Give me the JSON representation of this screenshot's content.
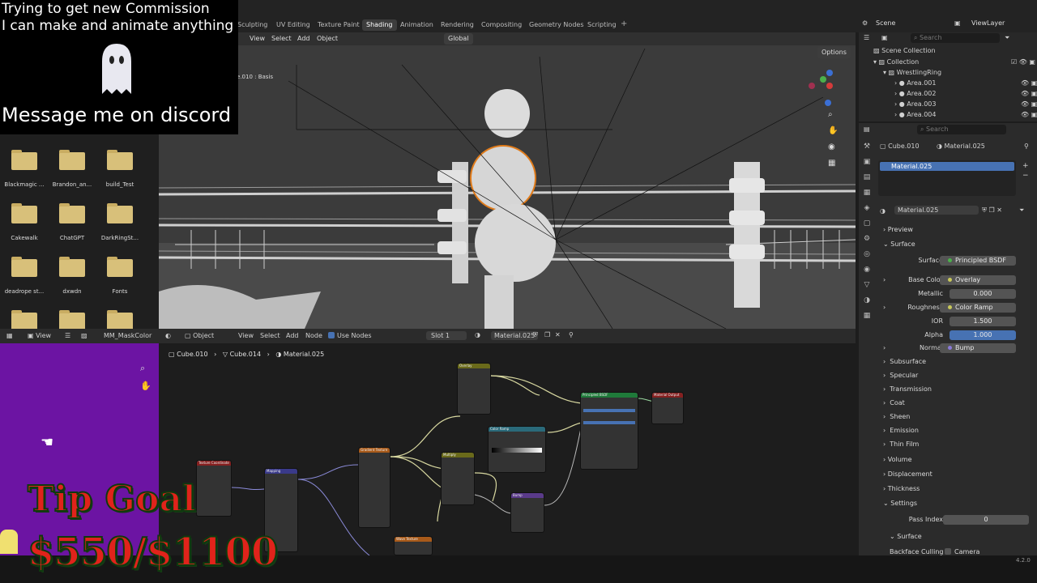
{
  "overlay": {
    "line1": "Trying to get new Commission",
    "line2": "I can make and animate anything",
    "line3": "Message me on discord"
  },
  "workspace_tabs": [
    "Sculpting",
    "UV Editing",
    "Texture Paint",
    "Shading",
    "Animation",
    "Rendering",
    "Compositing",
    "Geometry Nodes",
    "Scripting"
  ],
  "active_workspace": "Shading",
  "scene": "Scene",
  "view_layer": "ViewLayer",
  "viewport": {
    "menus": [
      "View",
      "Select",
      "Add",
      "Object"
    ],
    "orientation": "Global",
    "options": "Options",
    "object_label": "e.010 : Basis"
  },
  "files": [
    {
      "name": "Blackmagic ..."
    },
    {
      "name": "Brandon_an..."
    },
    {
      "name": "build_Test"
    },
    {
      "name": "Cakewalk"
    },
    {
      "name": "ChatGPT"
    },
    {
      "name": "DarkRingSt..."
    },
    {
      "name": "deadrope st..."
    },
    {
      "name": "dxwdn"
    },
    {
      "name": "Fonts"
    }
  ],
  "image_editor": {
    "view": "View",
    "image": "MM_MaskColor"
  },
  "node_editor": {
    "mode": "Object",
    "menus": [
      "View",
      "Select",
      "Add",
      "Node"
    ],
    "use_nodes": "Use Nodes",
    "slot": "Slot 1",
    "material": "Material.025",
    "breadcrumb": [
      "Cube.010",
      "Cube.014",
      "Material.025"
    ]
  },
  "nodes": [
    {
      "title": "Texture Coordinate",
      "color": "#862020"
    },
    {
      "title": "Mapping",
      "color": "#3a3a8a"
    },
    {
      "title": "Gradient Texture",
      "color": "#a85a1a"
    },
    {
      "title": "Overlay",
      "color": "#6a6a1a"
    },
    {
      "title": "Multiply",
      "color": "#6a6a1a"
    },
    {
      "title": "Color Ramp",
      "color": "#2a6a7a"
    },
    {
      "title": "Bump",
      "color": "#5a3a8a"
    },
    {
      "title": "Wave Texture",
      "color": "#a85a1a"
    },
    {
      "title": "Principled BSDF",
      "color": "#1f7a3a"
    },
    {
      "title": "Material Output",
      "color": "#862020"
    }
  ],
  "outliner": {
    "search": "Search",
    "root": "Scene Collection",
    "collection": "Collection",
    "group": "WrestlingRing",
    "items": [
      "Area.001",
      "Area.002",
      "Area.003",
      "Area.004"
    ]
  },
  "properties": {
    "search": "Search",
    "object": "Cube.010",
    "material_breadcrumb": "Material.025",
    "slot_item": "Material.025",
    "material_name": "Material.025",
    "panel_preview": "Preview",
    "panel_surface": "Surface",
    "rows": [
      {
        "label": "Surface",
        "value": "Principled BSDF"
      },
      {
        "label": "Base Color",
        "value": "Overlay"
      },
      {
        "label": "Metallic",
        "value": "0.000"
      },
      {
        "label": "Roughness",
        "value": "Color Ramp"
      },
      {
        "label": "IOR",
        "value": "1.500"
      },
      {
        "label": "Alpha",
        "value": "1.000"
      },
      {
        "label": "Normal",
        "value": "Bump"
      }
    ],
    "subpanels": [
      "Subsurface",
      "Specular",
      "Transmission",
      "Coat",
      "Sheen",
      "Emission",
      "Thin Film"
    ],
    "panels2": [
      "Volume",
      "Displacement",
      "Thickness",
      "Settings"
    ],
    "pass_index_label": "Pass Index",
    "pass_index": "0",
    "settings_surface": "Surface",
    "backface_label": "Backface Culling",
    "backface_camera": "Camera"
  },
  "tip_goal": {
    "title": "Tip Goal",
    "amount": "$550/$1100"
  },
  "version": "4.2.0",
  "colors": {
    "accent": "#4772b3",
    "purple": "#6c14a3",
    "tip_red": "#e0231b"
  }
}
